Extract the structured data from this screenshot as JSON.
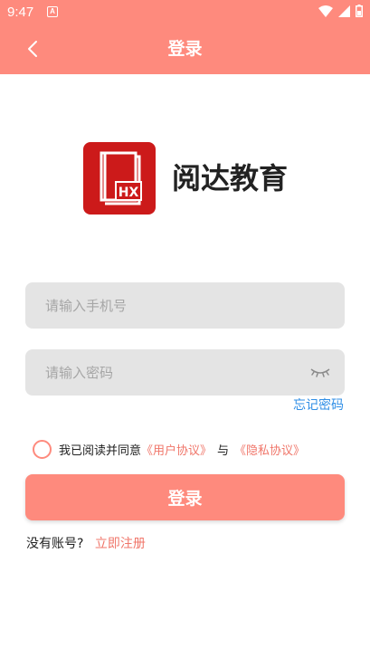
{
  "status_bar": {
    "time": "9:47",
    "notification_icon": "A"
  },
  "header": {
    "title": "登录",
    "background": "#fe8a7d"
  },
  "brand": {
    "name": "阅达教育",
    "logo_text": "HX",
    "logo_color": "#cc1a1a"
  },
  "form": {
    "phone_placeholder": "请输入手机号",
    "password_placeholder": "请输入密码",
    "forgot_label": "忘记密码"
  },
  "agreement": {
    "prefix": "我已阅读并同意",
    "user_agreement": "《用户协议》",
    "separator": "与",
    "privacy_policy": "《隐私协议》",
    "checked": false
  },
  "login_button": {
    "label": "登录"
  },
  "register": {
    "prompt": "没有账号?",
    "link": "立即注册"
  },
  "colors": {
    "accent": "#fe8a7d",
    "link_blue": "#2f8ee6",
    "link_red": "#f0766a"
  }
}
